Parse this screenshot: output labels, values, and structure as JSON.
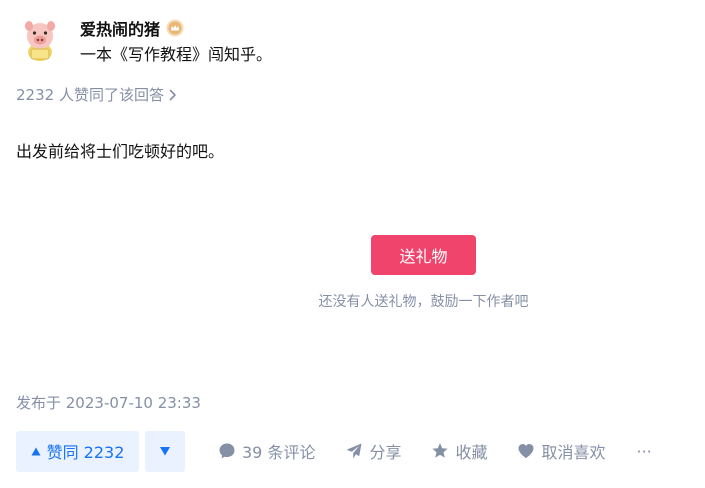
{
  "author": {
    "name": "爱热闹的猪",
    "headline": "一本《写作教程》闯知乎。",
    "avatar_icon": "pig-avatar",
    "badge_icon": "crown-badge"
  },
  "voters": {
    "text": "2232 人赞同了该回答",
    "chevron": "›"
  },
  "answer": {
    "content": "出发前给将士们吃顿好的吧。"
  },
  "gift": {
    "button_label": "送礼物",
    "hint": "还没有人送礼物，鼓励一下作者吧"
  },
  "publish_time": "发布于 2023-07-10 23:33",
  "actions": {
    "vote_up_label": "赞同 2232",
    "comment_label": "39 条评论",
    "share_label": "分享",
    "collect_label": "收藏",
    "like_label": "取消喜欢",
    "more_label": "···"
  },
  "colors": {
    "primary_blue": "#1772f6",
    "vote_bg": "#eaf2ff",
    "gray_text": "#8590a6",
    "gift_red": "#f1446c"
  }
}
